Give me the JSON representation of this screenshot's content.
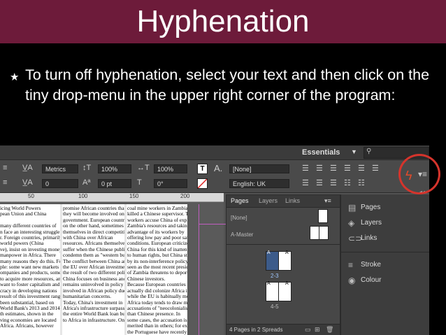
{
  "slide": {
    "title": "Hyphenation",
    "bullet": "To turn off hyphenation, select your text and then click on the tiny drop-menu in the upper right corner of the program:"
  },
  "app": {
    "workspace_label": "Essentials",
    "toolbar": {
      "font_field": "Metrics",
      "kerning_field": "0",
      "vscale_field": "100%",
      "hscale_field": "100%",
      "baseline_field": "0 pt",
      "skew_field": "0°",
      "char_style_field": "[None]",
      "language_field": "English: UK",
      "tracking_field_2": "100%"
    },
    "ruler": [
      "50",
      "100",
      "150",
      "200"
    ],
    "pages_panel": {
      "tabs": [
        "Pages",
        "Layers",
        "Links"
      ],
      "none_label": "[None]",
      "master_label": "A-Master",
      "spread_1": "2-3",
      "spread_2": "4-5",
      "thumb_letter": "A",
      "footer": "4 Pages in 2 Spreads"
    },
    "side_panel": [
      "Pages",
      "Layers",
      "Links",
      "Stroke",
      "Colour"
    ],
    "text_col1": [
      "icing World Powers",
      "pean Union and China",
      "",
      "many different countries of",
      "n face an interesting struggle",
      "r. Foreign countries, primarily",
      "world powers (China",
      "ve), insist on investing money",
      "manpower in Africa. There",
      "many reasons they do this. For",
      "ple: some want new markets",
      "ompanies and products, some",
      "to acquire more resources, and",
      "want to foster capitalism and",
      "cracy in developing nations",
      "result of this investment ranges",
      "been substantial, based on",
      "World Bank's 2013 and 2014",
      "th estimates, shown in the",
      "ving economies are located",
      "Africa. Africans, however"
    ],
    "text_col2": [
      "promise African countries that",
      "they will become involved only in",
      "government. European countries",
      "on the other hand, sometimes find",
      "themselves in direct competition",
      "with China over African",
      "resources. Africans themselves",
      "suffer when the Chinese publically",
      "condemn them as \"western bullies\"",
      "The conflict between China and",
      "the EU over African investment is",
      "the result of two different policies:",
      "China focuses on business and",
      "remains uninvolved in policy",
      "involved in African policy due to",
      "humanitarian concerns.",
      "Today, China's investment in",
      "Africa's infrastructure surpasses",
      "the entire World Bank loan budget",
      "to Africa in infrastructure. Once"
    ],
    "text_col3": [
      "coal mine workers in Zambia",
      "killed a Chinese supervisor. The",
      "workers accuse China of exploiting",
      "Zambia's resources and taking",
      "advantage of its workers by",
      "offering low pay and poor safety",
      "conditions. European criticize",
      "China for this kind of inattention",
      "to human rights, but China stands",
      "by its non-interference policy",
      "seen as the most recent president",
      "of Zambia threatens to deport",
      "Chinese investors.",
      "Because European countries",
      "actually did colonize Africa in the",
      "while the EU is habitually more",
      "Africa today tends to draw more",
      "accusations of \"neocolonialism\"",
      "than Chinese presence. In",
      "some cases, the accusation is more",
      "merited than in others; for example,",
      "the Portuguese have recently"
    ]
  }
}
